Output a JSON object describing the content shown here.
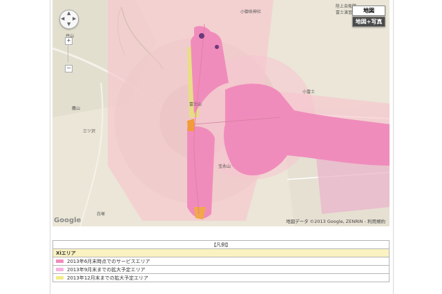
{
  "map": {
    "labels": {
      "tanuki_mountain": "丹山",
      "hoei_label": "宝永山",
      "fuji_summit_area": "富士山",
      "komitake_shrine": "小御岳神社",
      "fujisan_top": "陸上自衛隊\n富士演習",
      "koboku": "小富士",
      "mitsu": "三ツ沢",
      "takaba": "鷹山",
      "hakuba": "白塚"
    },
    "map_types": {
      "map": "地図",
      "satellite": "地図+写真"
    },
    "zoom": {
      "in": "+",
      "out": "−"
    },
    "google_logo": "Google",
    "copyright": "地図データ ©2013 Google, ZENRIN - 利用規約"
  },
  "legend": {
    "title": "【凡例】",
    "section": "Xiエリア",
    "items": [
      {
        "label": "2013年6月末時点でのサービスエリア",
        "color": "#f08cbb"
      },
      {
        "label": "2013年9月末までの拡大予定エリア",
        "color": "#f7b3de"
      },
      {
        "label": "2013年12月末までの拡大予定エリア",
        "color": "#f2ec8a"
      }
    ]
  }
}
